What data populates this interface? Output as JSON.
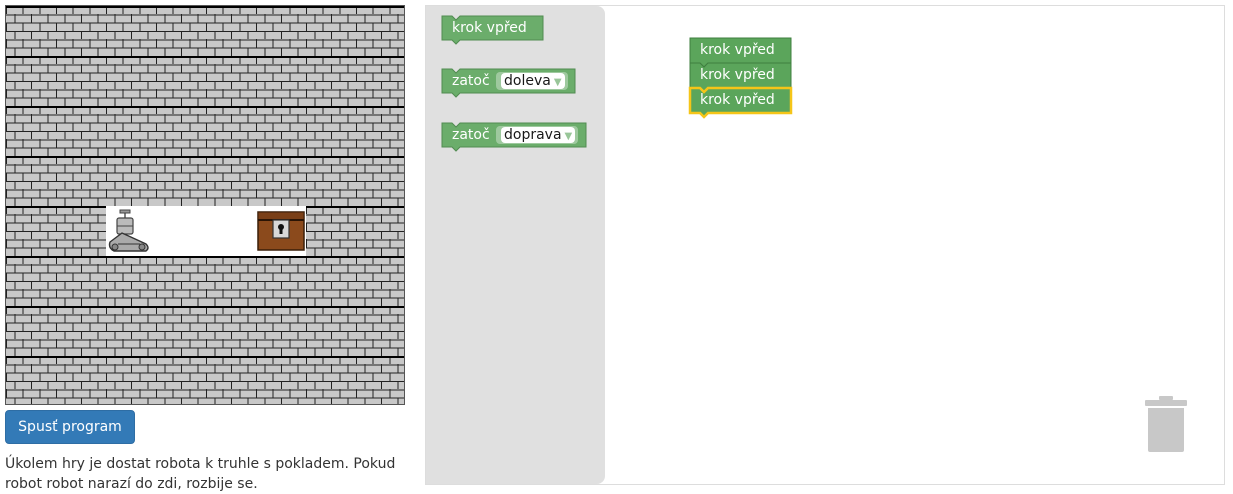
{
  "board": {
    "robot_icon": "robot-icon",
    "chest_icon": "treasure-chest-icon",
    "wall_icon": "brick-wall-icon"
  },
  "controls": {
    "run_label": "Spusť program",
    "task_text": "Úkolem hry je dostat robota k truhle s pokladem. Pokud robot robot narazí do zdi, rozbije se."
  },
  "toolbox": {
    "blocks": [
      {
        "label": "krok vpřed"
      },
      {
        "label": "zatoč",
        "option": "doleva"
      },
      {
        "label": "zatoč",
        "option": "doprava"
      }
    ]
  },
  "program": {
    "blocks": [
      {
        "label": "krok vpřed"
      },
      {
        "label": "krok vpřed"
      },
      {
        "label": "krok vpřed",
        "selected": true
      }
    ]
  },
  "colors": {
    "block_green": "#5ba55b",
    "block_border": "#3f7f3f",
    "selected_outline": "#f5c518",
    "run_button": "#337ab7",
    "toolbox_bg": "#dddddd"
  },
  "trash_icon": "trash-icon"
}
